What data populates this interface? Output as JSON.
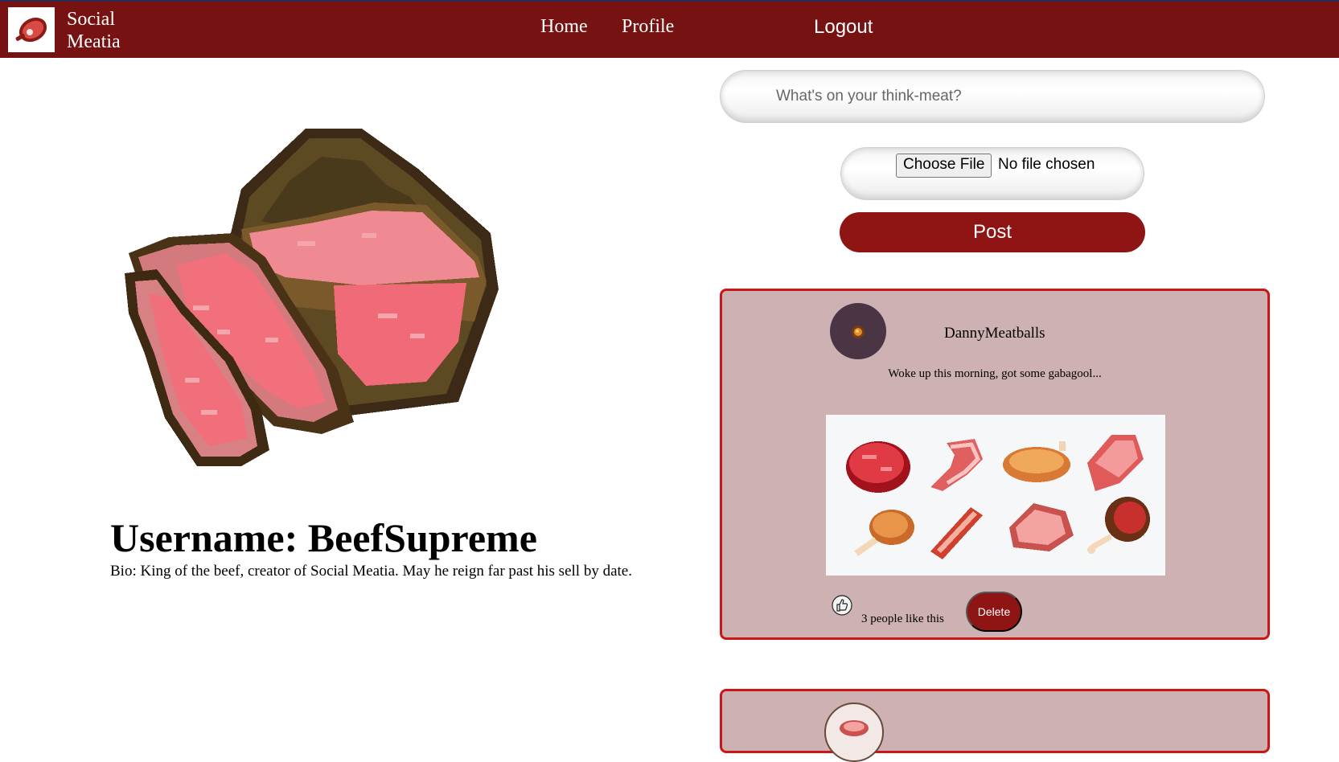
{
  "nav": {
    "brand_line1": "Social",
    "brand_line2": "Meatia",
    "logo_icon": "meat-steak-icon",
    "home": "Home",
    "profile": "Profile",
    "logout": "Logout"
  },
  "profile": {
    "image_icon": "sliced-steak-image",
    "username": "Username: BeefSupreme",
    "bio": "Bio: King of the beef, creator of Social Meatia. May he reign far past his sell by date."
  },
  "composer": {
    "placeholder": "What's on your think-meat?",
    "value": "",
    "choose_file": "Choose File",
    "no_file": "No file chosen",
    "post": "Post"
  },
  "posts": [
    {
      "username": "DannyMeatballs",
      "text": "Woke up this morning, got some gabagool...",
      "image": "pixel-meat-collection-image",
      "like_icon": "thumbs-up-icon",
      "likes_text": "3 people like this",
      "delete": "Delete"
    }
  ],
  "colors": {
    "nav_bg": "#771213",
    "button": "#8f1414",
    "card_bg": "#ceb1b2",
    "card_border": "#cc1515"
  }
}
